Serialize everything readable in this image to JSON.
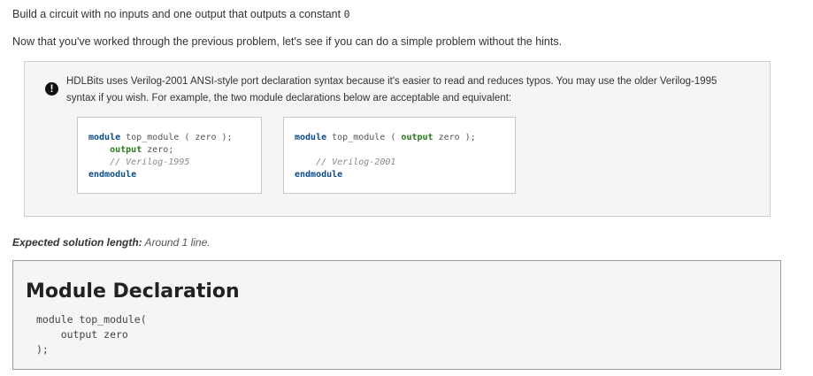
{
  "problem": {
    "statement_prefix": "Build a circuit with no inputs and one output that outputs a constant ",
    "statement_code": "0",
    "intro": "Now that you've worked through the previous problem, let's see if you can do a simple problem without the hints."
  },
  "note": {
    "icon": "exclamation-icon",
    "text": "HDLBits uses Verilog-2001 ANSI-style port declaration syntax because it's easier to read and reduces typos. You may use the older Verilog-1995 syntax if you wish. For example, the two module declarations below are acceptable and equivalent:",
    "left_code": {
      "l1_kw": "module",
      "l1_rest": " top_module ( zero );",
      "l2_indent": "    ",
      "l2_kw": "output",
      "l2_rest": " zero;",
      "l3": "    // Verilog-1995",
      "l4_kw": "endmodule"
    },
    "right_code": {
      "l1_kw": "module",
      "l1_mid": " top_module ( ",
      "l1_kw2": "output",
      "l1_rest": " zero );",
      "l2": "",
      "l3": "    // Verilog-2001",
      "l4_kw": "endmodule"
    }
  },
  "expected": {
    "label": "Expected solution length:",
    "value": " Around 1 line."
  },
  "declaration": {
    "title": "Module Declaration",
    "code": "module top_module(\n    output zero\n);"
  }
}
